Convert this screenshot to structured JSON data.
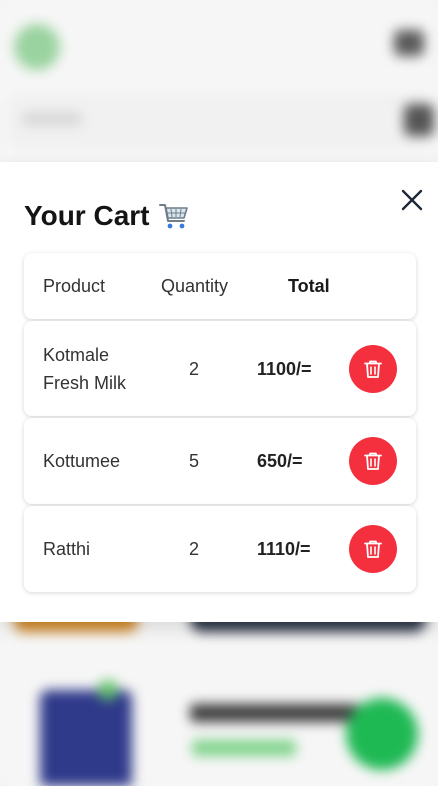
{
  "cart": {
    "title": "Your Cart",
    "title_icon": "shopping-cart-icon",
    "close_icon": "close-icon",
    "columns": {
      "product": "Product",
      "quantity": "Quantity",
      "total": "Total"
    },
    "items": [
      {
        "name_line1": "Kotmale",
        "name_line2": "Fresh Milk",
        "quantity": "2",
        "total": "1100/="
      },
      {
        "name_line1": "Kottumee",
        "name_line2": "",
        "quantity": "5",
        "total": "650/="
      },
      {
        "name_line1": "Ratthi",
        "name_line2": "",
        "quantity": "2",
        "total": "1110/="
      }
    ],
    "delete_icon": "trash-icon"
  },
  "colors": {
    "delete_button": "#f5303e",
    "fab": "#1fb954",
    "close_icon": "#1f2a3a"
  }
}
